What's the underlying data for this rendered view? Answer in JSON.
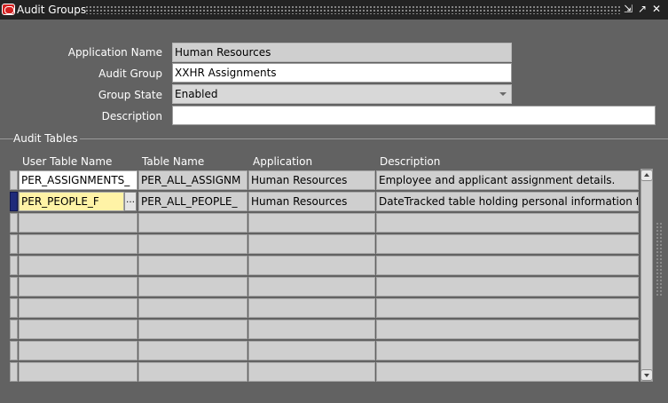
{
  "window": {
    "title": "Audit Groups",
    "controls": [
      "minimize-icon",
      "maximize-icon",
      "close-icon"
    ]
  },
  "form": {
    "application_name": {
      "label": "Application Name",
      "value": "Human Resources"
    },
    "audit_group": {
      "label": "Audit Group",
      "value": "XXHR Assignments"
    },
    "group_state": {
      "label": "Group State",
      "value": "Enabled"
    },
    "description": {
      "label": "Description",
      "value": ""
    }
  },
  "audit_tables": {
    "section_label": "Audit Tables",
    "columns": [
      "User Table Name",
      "Table Name",
      "Application",
      "Description"
    ],
    "rows": [
      {
        "user_table_name": "PER_ASSIGNMENTS_",
        "table_name": "PER_ALL_ASSIGNM",
        "application": "Human Resources",
        "description": "Employee and applicant assignment details."
      },
      {
        "user_table_name": "PER_PEOPLE_F",
        "table_name": "PER_ALL_PEOPLE_",
        "application": "Human Resources",
        "description": "DateTracked table holding personal information for"
      }
    ],
    "empty_row_count": 8
  },
  "colors": {
    "background": "#626262",
    "titlebar": "#232323",
    "field_readonly": "#cfcfcf",
    "field_active": "#fff3a6",
    "record_indicator": "#1f2a7a"
  }
}
